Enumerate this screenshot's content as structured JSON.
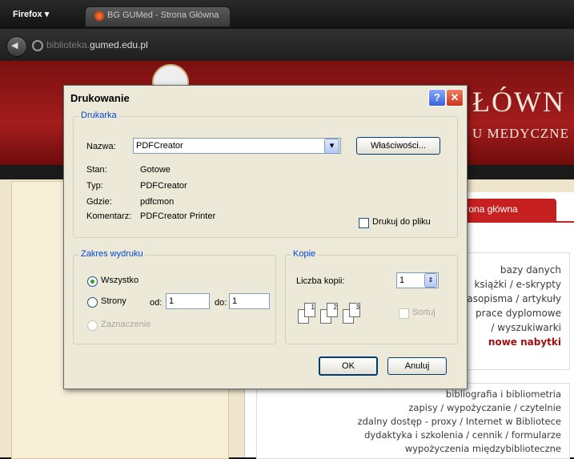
{
  "browser": {
    "menu_button": "Firefox ▾",
    "tab_title": "BG GUMed - Strona Główna",
    "url_dim": "biblioteka.",
    "url_main": "gumed.edu.pl"
  },
  "site": {
    "header_title": "ŁÓWN",
    "header_subtitle": "U MEDYCZNE",
    "home_tab": "strona główna",
    "box1_links": [
      "bazy danych",
      "książki / e-skrypty",
      "czasopisma / artykuły",
      "prace dyplomowe",
      "/ wyszukiwarki",
      "nowe nabytki"
    ],
    "box2_links": [
      "bibliografia i bibliometria",
      "zapisy / wypożyczanie / czytelnie",
      "zdalny dostęp - proxy / Internet w Bibliotece",
      "dydaktyka i szkolenia / cennik / formularze",
      "wypożyczenia międzybiblioteczne"
    ]
  },
  "dialog": {
    "title": "Drukowanie",
    "printer_group": "Drukarka",
    "name_label": "Nazwa:",
    "name_value": "PDFCreator",
    "properties_button": "Właściwości...",
    "status_label": "Stan:",
    "status_value": "Gotowe",
    "type_label": "Typ:",
    "type_value": "PDFCreator",
    "where_label": "Gdzie:",
    "where_value": "pdfcmon",
    "comment_label": "Komentarz:",
    "comment_value": "PDFCreator Printer",
    "print_to_file": "Drukuj do pliku",
    "range_group": "Zakres wydruku",
    "all_option": "Wszystko",
    "pages_option": "Strony",
    "from_label": "od:",
    "from_value": "1",
    "to_label": "do:",
    "to_value": "1",
    "selection_option": "Zaznaczenie",
    "copies_group": "Kopie",
    "copies_label": "Liczba kopii:",
    "copies_value": "1",
    "collate_label": "Sortuj",
    "ok_button": "OK",
    "cancel_button": "Anuluj",
    "help_button": "?",
    "close_button": "✕"
  },
  "colors": {
    "dialog_bg": "#ece9d8",
    "group_title": "#0046d5",
    "header_red": "#a41d1d"
  }
}
